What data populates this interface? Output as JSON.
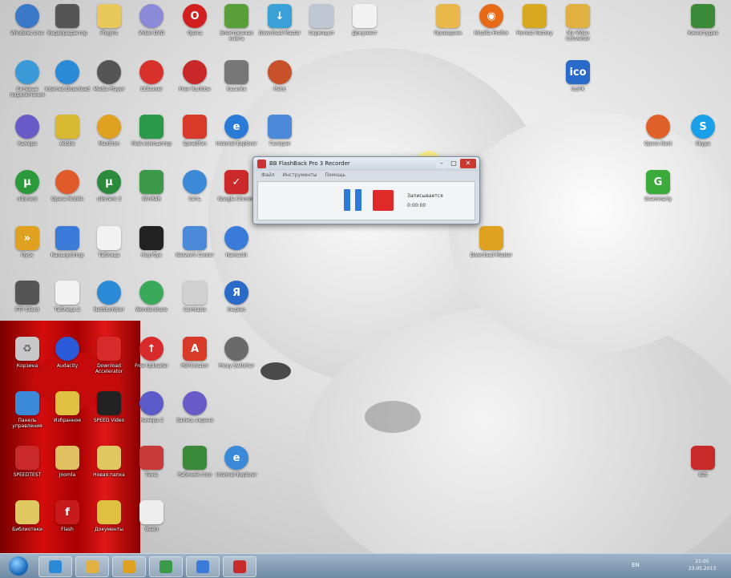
{
  "colors": {
    "accent": "#2b7ad8",
    "record_red": "#e02a2a",
    "taskbar": "#7f98b1"
  },
  "desktop_icons": [
    {
      "label": "Windows Live",
      "icon": "live-icon",
      "color": "#3a78c8",
      "round": true
    },
    {
      "label": "Видеоредактор",
      "icon": "film-icon",
      "color": "#555555",
      "round": false
    },
    {
      "label": "Plugins",
      "icon": "folder-icon",
      "color": "#e8c85a",
      "round": false
    },
    {
      "label": "Video DVD",
      "icon": "dvd-icon",
      "color": "#8a8ad8",
      "round": true
    },
    {
      "label": "Opera",
      "icon": "opera-icon",
      "color": "#d21f1f",
      "round": true
    },
    {
      "label": "Электронная книга",
      "icon": "book-icon",
      "color": "#5a9e3a",
      "round": false
    },
    {
      "label": "Download Master",
      "icon": "download-icon",
      "color": "#3aa0d8",
      "round": false
    },
    {
      "label": "Скриншот",
      "icon": "screenshot-icon",
      "color": "#bfc7d3",
      "round": false
    },
    {
      "label": "Документ",
      "icon": "document-icon",
      "color": "#f2f2f2",
      "round": false
    },
    {
      "label": "Проводник",
      "icon": "explorer-icon",
      "color": "#e8b84a",
      "round": false
    },
    {
      "label": "Mozilla Firefox",
      "icon": "firefox-icon",
      "color": "#e76a16",
      "round": true
    },
    {
      "label": "Format Factory",
      "icon": "tools-icon",
      "color": "#d8a820",
      "round": false
    },
    {
      "label": "My Video Converter",
      "icon": "converter-icon",
      "color": "#e0b040",
      "round": false
    },
    {
      "label": "Киностудия",
      "icon": "movie-icon",
      "color": "#3a8a3a",
      "round": false
    },
    {
      "label": "Сетевые подключения",
      "icon": "network-icon",
      "color": "#3a9ad8",
      "round": true
    },
    {
      "label": "Internet Download",
      "icon": "idm-icon",
      "color": "#2a8ad8",
      "round": true
    },
    {
      "label": "Media Player",
      "icon": "player-icon",
      "color": "#555555",
      "round": true
    },
    {
      "label": "CCleaner",
      "icon": "ccleaner-icon",
      "color": "#d8302a",
      "round": true
    },
    {
      "label": "Free YouTube",
      "icon": "youtube-icon",
      "color": "#c82828",
      "round": true
    },
    {
      "label": "Karaoke",
      "icon": "microphone-icon",
      "color": "#777777",
      "round": false
    },
    {
      "label": "Paint",
      "icon": "palette-icon",
      "color": "#c8502a",
      "round": true
    },
    {
      "label": "IcoFX",
      "icon": "ico-icon",
      "color": "#2a6ac8",
      "round": false
    },
    {
      "label": "Камера",
      "icon": "camera-icon",
      "color": "#6a5ac8",
      "round": true
    },
    {
      "label": "Adobe",
      "icon": "adobe-icon",
      "color": "#d8b830",
      "round": false
    },
    {
      "label": "Maxthon",
      "icon": "globe-icon",
      "color": "#e0a020",
      "round": true
    },
    {
      "label": "Мой компьютер",
      "icon": "monitor-icon",
      "color": "#2a9a4a",
      "round": false
    },
    {
      "label": "SpeedFan",
      "icon": "fan-icon",
      "color": "#d83a2a",
      "round": false
    },
    {
      "label": "Internet Explorer",
      "icon": "ie-icon",
      "color": "#2a7ad8",
      "round": true
    },
    {
      "label": "Галерея",
      "icon": "photo-icon",
      "color": "#4a8ad8",
      "round": false
    },
    {
      "label": "Opera Next",
      "icon": "opera-next-icon",
      "color": "#e0602a",
      "round": true
    },
    {
      "label": "Skype",
      "icon": "skype-icon",
      "color": "#1aa0e8",
      "round": true
    },
    {
      "label": "uTorrent",
      "icon": "utorrent-icon",
      "color": "#2a9a3a",
      "round": true
    },
    {
      "label": "Opera Mobile",
      "icon": "opera-mobile-icon",
      "color": "#e05a2a",
      "round": true
    },
    {
      "label": "uTorrent 3",
      "icon": "utorrent2-icon",
      "color": "#2a8a3a",
      "round": true
    },
    {
      "label": "WinRAR",
      "icon": "winrar-icon",
      "color": "#3a9a4a",
      "round": false
    },
    {
      "label": "Сеть",
      "icon": "earth-icon",
      "color": "#3a8ad8",
      "round": true
    },
    {
      "label": "Google Chrome",
      "icon": "checkmark-icon",
      "color": "#cc2a2a",
      "round": false
    },
    {
      "label": "Grammarly",
      "icon": "g-icon",
      "color": "#3aaa3a",
      "round": false
    },
    {
      "label": "Пуск",
      "icon": "arrow-icon",
      "color": "#e0a020",
      "round": false
    },
    {
      "label": "Калькулятор",
      "icon": "calculator-icon",
      "color": "#3a7ad8",
      "round": false
    },
    {
      "label": "Таблица",
      "icon": "table-icon",
      "color": "#f2f2f2",
      "round": false
    },
    {
      "label": "Ноутбук",
      "icon": "laptop-icon",
      "color": "#222222",
      "round": false
    },
    {
      "label": "Network Center",
      "icon": "network2-icon",
      "color": "#4a8ad8",
      "round": false
    },
    {
      "label": "Hamachi",
      "icon": "gear-icon",
      "color": "#3a7ad8",
      "round": true
    },
    {
      "label": "Download Master",
      "icon": "download2-icon",
      "color": "#e0a020",
      "round": false
    },
    {
      "label": "FTP Client",
      "icon": "ftp-icon",
      "color": "#555555",
      "round": false
    },
    {
      "label": "Таблица 2",
      "icon": "table2-icon",
      "color": "#f2f2f2",
      "round": false
    },
    {
      "label": "NetStumbler",
      "icon": "search-icon",
      "color": "#2a8ad8",
      "round": true
    },
    {
      "label": "Wondershare",
      "icon": "headphones-icon",
      "color": "#3aaa5a",
      "round": true
    },
    {
      "label": "Camtasia",
      "icon": "camtasia-icon",
      "color": "#d0d0d0",
      "round": false
    },
    {
      "label": "Яндекс",
      "icon": "yandex-icon",
      "color": "#2a6ac8",
      "round": true
    },
    {
      "label": "Корзина",
      "icon": "recycle-bin-icon",
      "color": "#c8c8c8",
      "round": false
    },
    {
      "label": "Audacity",
      "icon": "audio-icon",
      "color": "#2a5ad8",
      "round": true
    },
    {
      "label": "Download Accelerator",
      "icon": "accelerator-icon",
      "color": "#d82a2a",
      "round": false
    },
    {
      "label": "Free Uploader",
      "icon": "upload-icon",
      "color": "#d82a2a",
      "round": true
    },
    {
      "label": "PDFCreator",
      "icon": "pdf-icon",
      "color": "#d83a2a",
      "round": false
    },
    {
      "label": "Proxy Switcher",
      "icon": "proxy-icon",
      "color": "#6a6a6a",
      "round": true
    },
    {
      "label": "Панель управления",
      "icon": "control-panel-icon",
      "color": "#3a8ad8",
      "round": false
    },
    {
      "label": "Избранное",
      "icon": "star-folder-icon",
      "color": "#e0c040",
      "round": false
    },
    {
      "label": "SPEED Video",
      "icon": "video-download-icon",
      "color": "#222222",
      "round": false
    },
    {
      "label": "Камера 2",
      "icon": "webcam-icon",
      "color": "#5a5ac8",
      "round": true
    },
    {
      "label": "Запись экрана",
      "icon": "record-icon",
      "color": "#6a5ac8",
      "round": true
    },
    {
      "label": "SPEEDTEST",
      "icon": "speedtest-icon",
      "color": "#c82a2a",
      "round": false
    },
    {
      "label": "Joomla",
      "icon": "folder2-icon",
      "color": "#e0c060",
      "round": false
    },
    {
      "label": "Новая папка",
      "icon": "folder3-icon",
      "color": "#e0c860",
      "round": false
    },
    {
      "label": "Тема",
      "icon": "theme-icon",
      "color": "#c83a3a",
      "round": false
    },
    {
      "label": "Рабочий стол",
      "icon": "desktop-icon",
      "color": "#3a8a3a",
      "round": false
    },
    {
      "label": "Internet Explorer",
      "icon": "ie2-icon",
      "color": "#3a8ad8",
      "round": true
    },
    {
      "label": "Gift",
      "icon": "gift-icon",
      "color": "#c82a2a",
      "round": false
    },
    {
      "label": "Библиотеки",
      "icon": "folder4-icon",
      "color": "#e0c860",
      "round": false
    },
    {
      "label": "Flash",
      "icon": "flash-icon",
      "color": "#c81a1a",
      "round": false
    },
    {
      "label": "Документы",
      "icon": "folder5-icon",
      "color": "#e0c040",
      "round": false
    },
    {
      "label": "Файл",
      "icon": "file-icon",
      "color": "#eeeeee",
      "round": false
    }
  ],
  "recorder": {
    "title": "BB FlashBack Pro 3 Recorder",
    "menu": [
      "Файл",
      "Инструменты",
      "Помощь"
    ],
    "status": "Записывается",
    "time": "0:00:00",
    "pause_label": "Pause",
    "stop_label": "Stop"
  },
  "taskbar": {
    "buttons": [
      {
        "name": "ie",
        "color": "#2a8ad8"
      },
      {
        "name": "explorer",
        "color": "#e0b040"
      },
      {
        "name": "skype",
        "color": "#e0a020"
      },
      {
        "name": "maxthon",
        "color": "#3a9a4a"
      },
      {
        "name": "network",
        "color": "#3a7ad8"
      },
      {
        "name": "recorder",
        "color": "#c82a2a"
      }
    ],
    "lang": "EN",
    "time": "21:05",
    "date": "23.05.2013"
  }
}
